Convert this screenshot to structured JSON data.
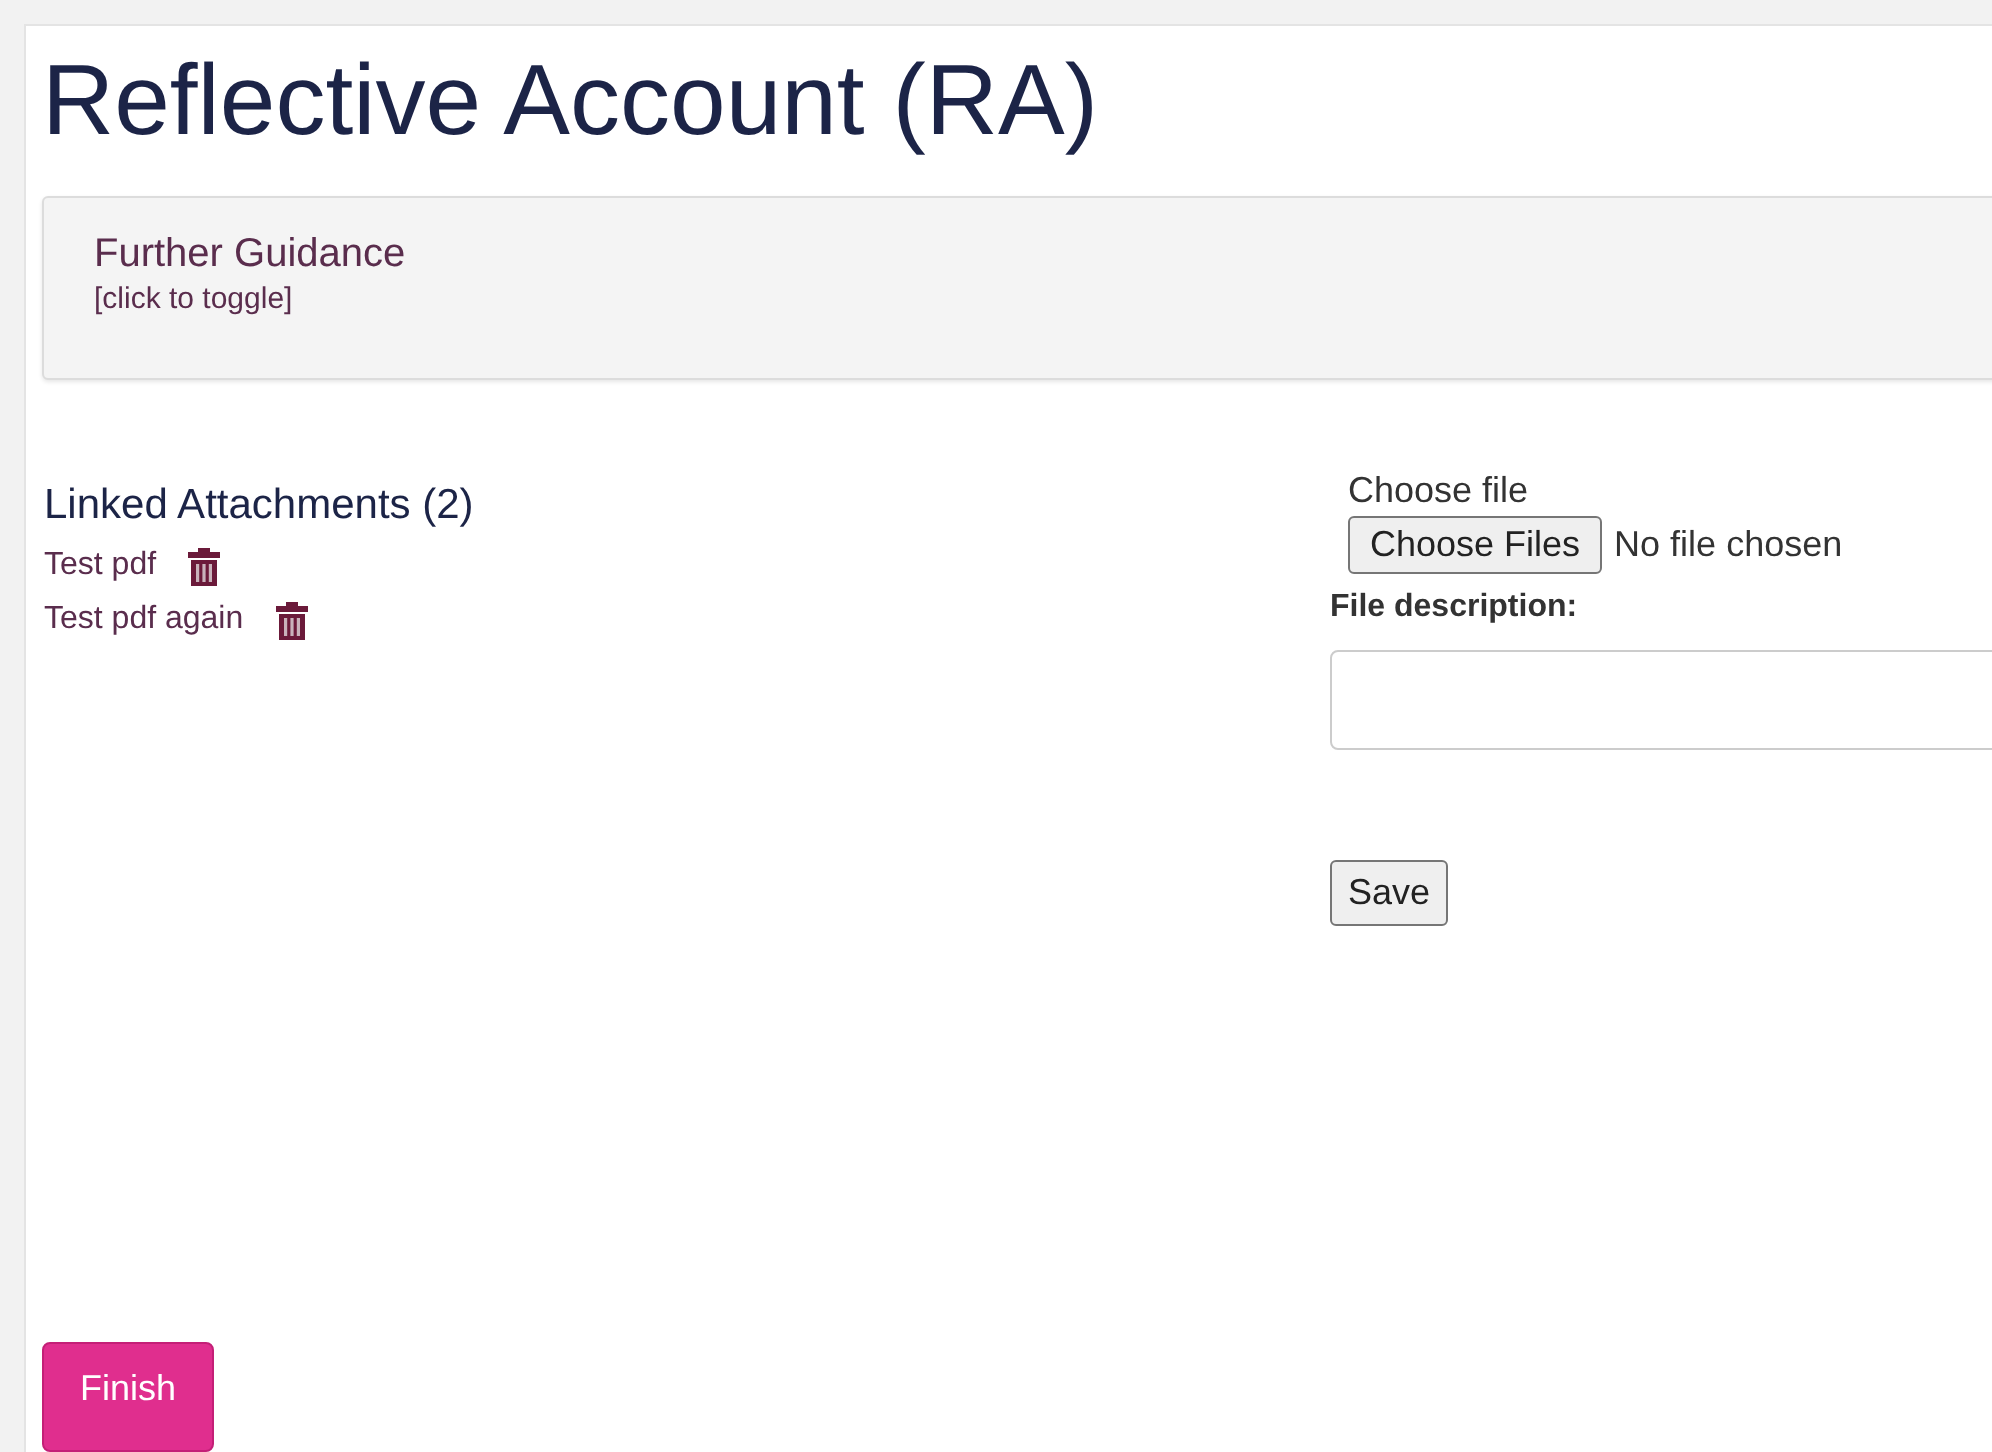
{
  "title": "Reflective Account (RA)",
  "guidance": {
    "heading": "Further Guidance",
    "hint": "[click to toggle]"
  },
  "attachments": {
    "heading": "Linked Attachments (2)",
    "items": [
      {
        "name": "Test pdf"
      },
      {
        "name": "Test pdf again"
      }
    ]
  },
  "upload": {
    "label": "Choose file",
    "button": "Choose Files",
    "status": "No file chosen",
    "description_label": "File description:",
    "save": "Save"
  },
  "finish": "Finish"
}
